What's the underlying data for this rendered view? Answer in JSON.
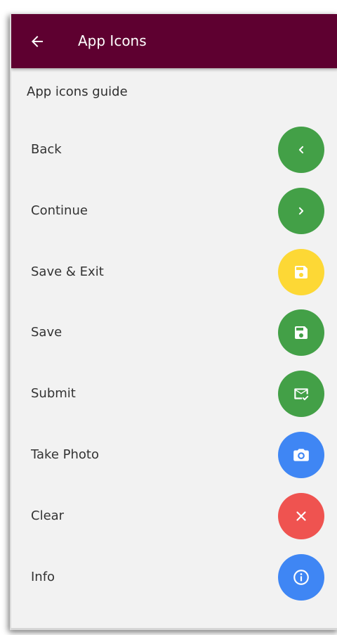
{
  "app_bar": {
    "title": "App Icons",
    "back_icon": "arrow-left-icon"
  },
  "page": {
    "title": "App icons guide"
  },
  "items": [
    {
      "label": "Back",
      "icon": "chevron-left-icon",
      "color": "#43a047"
    },
    {
      "label": "Continue",
      "icon": "chevron-right-icon",
      "color": "#43a047"
    },
    {
      "label": "Save & Exit",
      "icon": "floppy-disk-icon",
      "color": "#fdd835"
    },
    {
      "label": "Save",
      "icon": "floppy-disk-icon",
      "color": "#43a047"
    },
    {
      "label": "Submit",
      "icon": "mail-check-icon",
      "color": "#43a047"
    },
    {
      "label": "Take Photo",
      "icon": "camera-icon",
      "color": "#3f86f4"
    },
    {
      "label": "Clear",
      "icon": "close-icon",
      "color": "#ef5350"
    },
    {
      "label": "Info",
      "icon": "info-icon",
      "color": "#3f86f4"
    }
  ],
  "colors": {
    "app_bar": "#5e0030",
    "background": "#f2f2f2"
  }
}
